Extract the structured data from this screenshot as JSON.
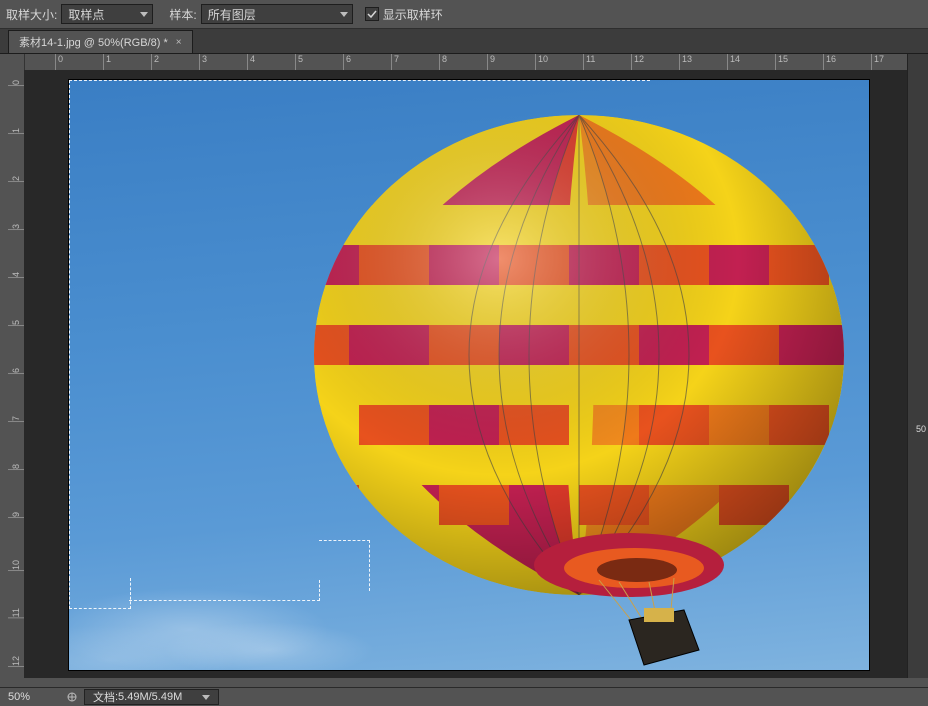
{
  "toolbar": {
    "sample_size_label": "取样大小:",
    "sample_size_value": "取样点",
    "sample_label": "样本:",
    "sample_value": "所有图层",
    "show_ring_label": "显示取样环",
    "show_ring_checked": true
  },
  "tab": {
    "title": "素材14-1.jpg @ 50%(RGB/8) *",
    "close": "×"
  },
  "ruler": {
    "h": [
      "0",
      "1",
      "2",
      "3",
      "4",
      "5",
      "6",
      "7",
      "8",
      "9",
      "10",
      "11",
      "12",
      "13",
      "14",
      "15",
      "16",
      "17"
    ],
    "v": [
      "0",
      "1",
      "2",
      "3",
      "4",
      "5",
      "6",
      "7",
      "8",
      "9",
      "10",
      "11",
      "12"
    ]
  },
  "status": {
    "zoom": "50%",
    "doc_label": "文档",
    "doc_value": ":5.49M/5.49M"
  },
  "panel_hint": "50"
}
